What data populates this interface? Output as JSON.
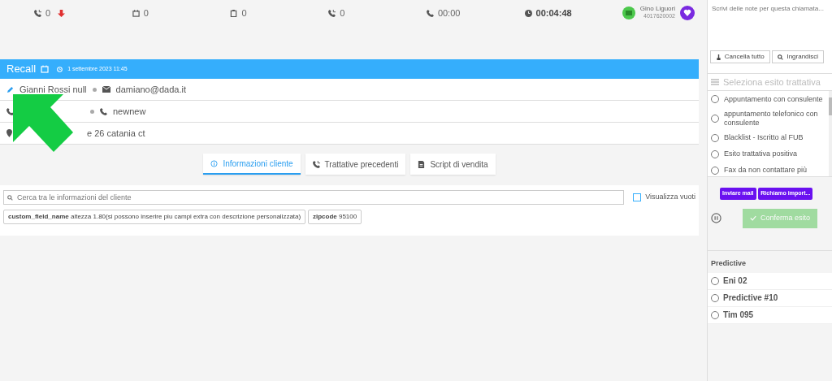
{
  "stats": [
    {
      "kind": "calls",
      "value": "0",
      "alert": true
    },
    {
      "kind": "calendar",
      "value": "0"
    },
    {
      "kind": "clipboard",
      "value": "0"
    },
    {
      "kind": "calls",
      "value": "0"
    },
    {
      "kind": "phone",
      "value": "00:00"
    },
    {
      "kind": "clock",
      "value": "00:04:48"
    }
  ],
  "agent": {
    "name": "Gino Liguori",
    "number": "4017620002"
  },
  "recall": {
    "title": "Recall",
    "datetime": "1 settembre 2023 11:45"
  },
  "contact": {
    "name": "Gianni Rossi null",
    "email": "damiano@dada.it",
    "phone2": "newnew",
    "address": "e 26 catania ct"
  },
  "tabs": [
    {
      "kind": "info",
      "label": "Informazioni cliente",
      "selected": true
    },
    {
      "kind": "calls",
      "label": "Trattative precedenti",
      "selected": false
    },
    {
      "kind": "doc",
      "label": "Script di vendita",
      "selected": false
    }
  ],
  "search": {
    "placeholder": "Cerca tra le informazioni del cliente"
  },
  "show_empty": {
    "label": "Visualizza vuoti",
    "checked": false
  },
  "fields": [
    {
      "name": "custom_field_name",
      "value": "altezza 1.80(si possono inserire piu campi extra con descrizione personalizzata)"
    },
    {
      "name": "zipcode",
      "value": "95100"
    }
  ],
  "notes": {
    "placeholder": "Scrivi delle note per questa chiamata..."
  },
  "note_buttons": [
    {
      "kind": "clear",
      "label": "Cancella tutto"
    },
    {
      "kind": "zoom",
      "label": "Ingrandisci"
    }
  ],
  "outcome": {
    "title": "Seleziona esito trattativa",
    "options": [
      {
        "label": "Appuntamento con consulente",
        "selected": false
      },
      {
        "label": "appuntamento telefonico con consulente",
        "selected": false
      },
      {
        "label": "Blacklist - Iscritto al FUB",
        "selected": false
      },
      {
        "label": "Esito trattativa positiva",
        "selected": false
      },
      {
        "label": "Fax da non contattare più",
        "selected": false
      }
    ]
  },
  "tags": [
    "Inviare mail",
    "Richiamo import..."
  ],
  "confirm": {
    "label": "Conferma esito",
    "disabled": true
  },
  "predictive": {
    "title": "Predictive",
    "items": [
      {
        "label": "Eni 02",
        "selected": false
      },
      {
        "label": "Predictive #10",
        "selected": false
      },
      {
        "label": "Tim 095",
        "selected": false
      }
    ]
  }
}
